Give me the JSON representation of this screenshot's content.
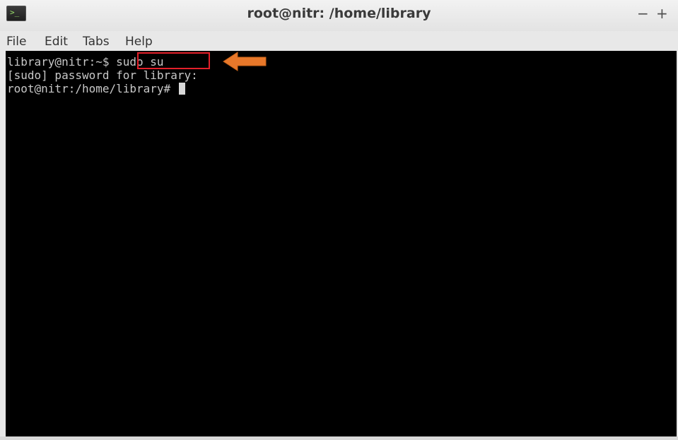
{
  "window": {
    "title": "root@nitr: /home/library",
    "minimize_label": "−",
    "maximize_label": "+",
    "app_icon": "terminal-icon"
  },
  "menu": {
    "items": [
      "File",
      "Edit",
      "Tabs",
      "Help"
    ]
  },
  "terminal": {
    "lines": [
      {
        "prompt": "library@nitr:~$ ",
        "command": "sudo su"
      },
      {
        "text": "[sudo] password for library:"
      },
      {
        "prompt": "root@nitr:/home/library# ",
        "command": ""
      }
    ]
  },
  "annotation": {
    "highlight_color": "#e3202a",
    "arrow_color": "#e8782a"
  },
  "colors": {
    "terminal_bg": "#000000",
    "terminal_fg": "#c8c8c8",
    "titlebar_bg": "#ececec"
  }
}
